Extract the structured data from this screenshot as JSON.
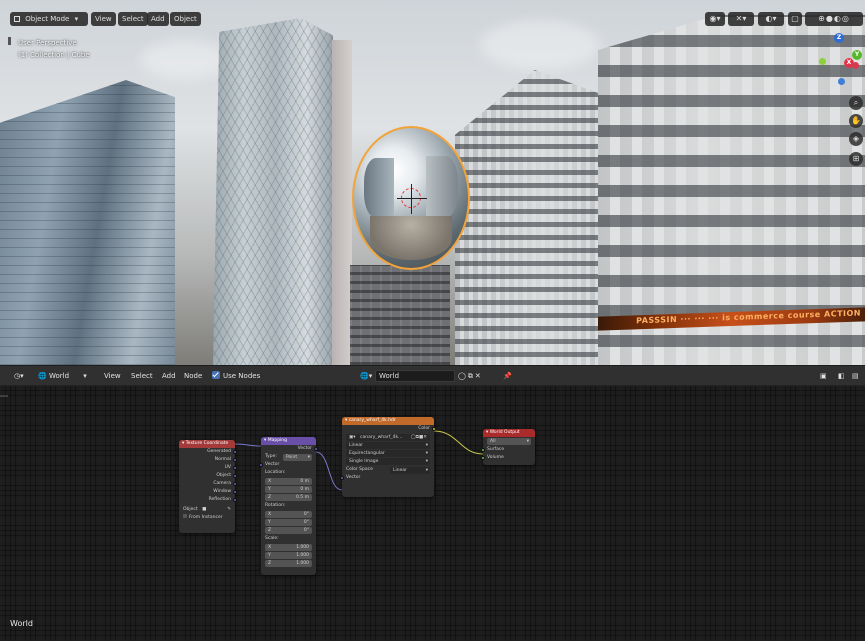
{
  "viewport": {
    "mode_label": "Object Mode",
    "menu": [
      "View",
      "Select",
      "Add",
      "Object"
    ],
    "overlay_line1": "User Perspective",
    "overlay_line2": "(1) Collection | Cube",
    "ticker_text": "PASSSIN ··· ··· ··· is commerce course ACTION",
    "gizmo": {
      "z": "Z",
      "y": "Y",
      "x": "X"
    }
  },
  "node_editor": {
    "header": {
      "editor_type_icon": "world-icon",
      "world_label": "World",
      "menu": [
        "View",
        "Select",
        "Add",
        "Node"
      ],
      "use_nodes_label": "Use Nodes",
      "world_datablock": "World"
    },
    "footer_label": "World",
    "nodes": {
      "texcoord": {
        "title": "Texture Coordinate",
        "outputs": [
          "Generated",
          "Normal",
          "UV",
          "Object",
          "Camera",
          "Window",
          "Reflection"
        ],
        "object_label": "Object",
        "from_instancer": "From Instancer",
        "color": "#a53a3a"
      },
      "mapping": {
        "title": "Mapping",
        "output": "Vector",
        "type_label": "Type:",
        "type_value": "Point",
        "vector_label": "Vector",
        "location_label": "Location:",
        "location": [
          {
            "axis": "X",
            "value": "0 m"
          },
          {
            "axis": "Y",
            "value": "0 m"
          },
          {
            "axis": "Z",
            "value": "0.5 m"
          }
        ],
        "rotation_label": "Rotation:",
        "rotation": [
          {
            "axis": "X",
            "value": "0°"
          },
          {
            "axis": "Y",
            "value": "0°"
          },
          {
            "axis": "Z",
            "value": "0°"
          }
        ],
        "scale_label": "Scale:",
        "scale": [
          {
            "axis": "X",
            "value": "1.000"
          },
          {
            "axis": "Y",
            "value": "1.000"
          },
          {
            "axis": "Z",
            "value": "1.000"
          }
        ],
        "color": "#6a4fa8"
      },
      "envtex": {
        "title": "canary_wharf_4k.hdr",
        "output": "Color",
        "image_name": "canary_wharf_4k...",
        "interpolation": "Linear",
        "projection": "Equirectangular",
        "source": "Single Image",
        "color_space_label": "Color Space",
        "color_space": "Linear",
        "input": "Vector",
        "color": "#c26a2a"
      },
      "output": {
        "title": "World Output",
        "target": "All",
        "inputs": [
          "Surface",
          "Volume"
        ],
        "color": "#a92b2b"
      }
    }
  },
  "colors": {
    "accent_blue": "#4772b3",
    "selection_outline": "#f2a33a",
    "socket_vector": "#6363c7",
    "socket_color": "#c7c729",
    "socket_shader": "#63c763"
  }
}
